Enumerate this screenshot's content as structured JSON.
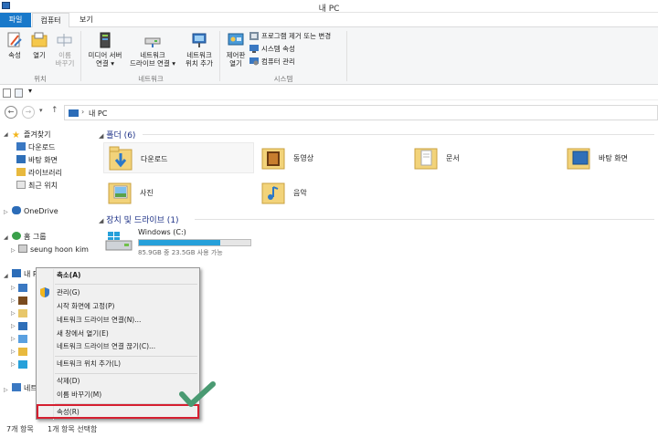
{
  "window": {
    "title": "내 PC"
  },
  "tabs": [
    {
      "label": "파일"
    },
    {
      "label": "컴퓨터"
    },
    {
      "label": "보기"
    }
  ],
  "ribbon": {
    "location_group": {
      "label": "위치",
      "properties": "속성",
      "open": "열기",
      "rename_line1": "이름",
      "rename_line2": "바꾸기"
    },
    "network_group": {
      "label": "네트워크",
      "media_line1": "미디어 서버",
      "media_line2": "연결",
      "map_line1": "네트워크",
      "map_line2": "드라이브 연결",
      "add_line1": "네트워크",
      "add_line2": "위치 추가"
    },
    "system_group": {
      "label": "시스템",
      "control_line1": "제어판",
      "control_line2": "열기",
      "uninstall": "프로그램 제거 또는 변경",
      "system_properties": "시스템 속성",
      "manage": "컴퓨터 관리"
    }
  },
  "address": {
    "crumb": "내 PC",
    "separator": "›"
  },
  "nav": {
    "favorites": "즐겨찾기",
    "downloads": "다운로드",
    "desktop": "바탕 화면",
    "libraries": "라이브러리",
    "recent": "최근 위치",
    "onedrive": "OneDrive",
    "homegroup": "홈 그룹",
    "user": "seung hoon kim",
    "thispc": "내 PC",
    "network": "네트"
  },
  "content": {
    "folders_header": "폴더 (6)",
    "folders": [
      {
        "label": "다운로드"
      },
      {
        "label": "동영상"
      },
      {
        "label": "문서"
      },
      {
        "label": "바탕 화면"
      },
      {
        "label": "사진"
      },
      {
        "label": "음악"
      }
    ],
    "drives_header": "장치 및 드라이브 (1)",
    "drive": {
      "name": "Windows (C:)",
      "info": "85.9GB 중 23.5GB 사용 가능",
      "used_fraction": 0.73
    }
  },
  "context_menu": {
    "items": [
      "축소(A)",
      "관리(G)",
      "시작 화면에 고정(P)",
      "네트워크 드라이브 연결(N)...",
      "새 창에서 열기(E)",
      "네트워크 드라이브 연결 끊기(C)...",
      "네트워크 위치 추가(L)",
      "삭제(D)",
      "이름 바꾸기(M)",
      "속성(R)"
    ]
  },
  "status": {
    "count": "7개 항목",
    "selected": "1개 항목 선택함"
  },
  "colors": {
    "accent": "#1979ca",
    "highlight_box": "#d51f30",
    "check": "#4a9a72",
    "drive_fill": "#26a0da",
    "section_header": "#1e3287"
  }
}
